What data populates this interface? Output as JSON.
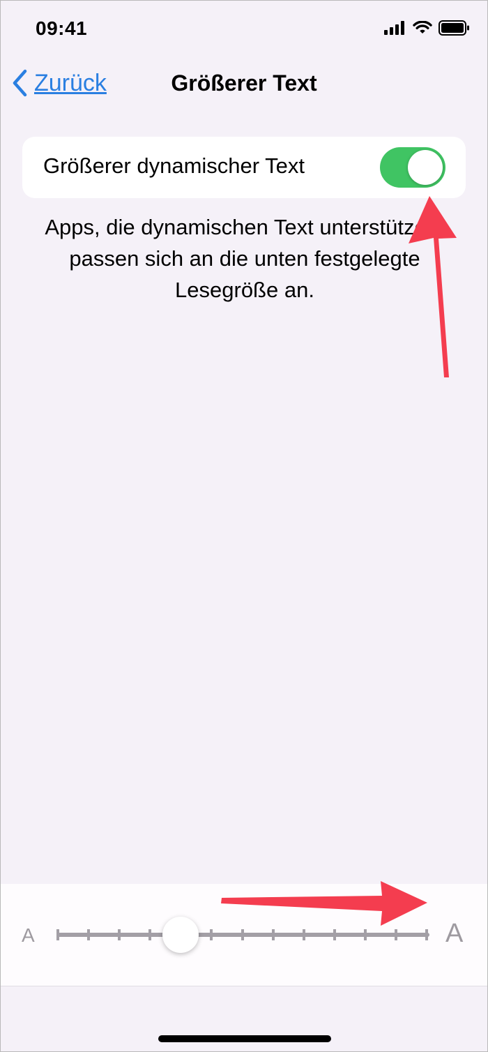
{
  "status_bar": {
    "time": "09:41"
  },
  "nav": {
    "back_label": "Zurück",
    "title": "Größerer Text"
  },
  "setting": {
    "label": "Größerer dynamischer Text",
    "enabled": true
  },
  "description": "Apps, die dynamischen Text unterstützen, passen sich an die unten festgelegte Lesegröße an.",
  "slider": {
    "min_label": "A",
    "max_label": "A",
    "steps": 12,
    "value_index": 4
  },
  "colors": {
    "accent": "#2a7fe1",
    "toggle_on": "#40c463",
    "annotation": "#f43d4f"
  },
  "icons": {
    "back": "chevron-left-icon",
    "signal": "cellular-signal-icon",
    "wifi": "wifi-icon",
    "battery": "battery-icon"
  }
}
